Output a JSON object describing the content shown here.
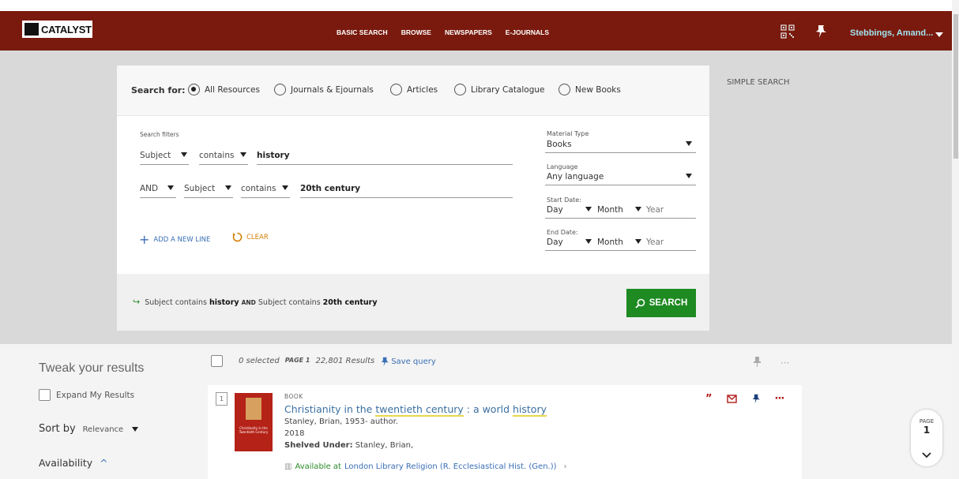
{
  "header": {
    "logo_text": "CATALYST",
    "nav": [
      "BASIC SEARCH",
      "BROWSE",
      "NEWSPAPERS",
      "E-JOURNALS"
    ],
    "user": "Stebbings, Amand...",
    "icons": [
      "qr-code-icon",
      "pin-icon",
      "caret-down-icon"
    ]
  },
  "search": {
    "search_for_label": "Search for:",
    "scopes": [
      {
        "label": "All Resources",
        "selected": true
      },
      {
        "label": "Journals & Ejournals",
        "selected": false
      },
      {
        "label": "Articles",
        "selected": false
      },
      {
        "label": "Library Catalogue",
        "selected": false
      },
      {
        "label": "New Books",
        "selected": false
      }
    ],
    "filters_label": "Search filters",
    "line1": {
      "field": "Subject",
      "op": "contains",
      "value": "history"
    },
    "line2": {
      "bool": "AND",
      "field": "Subject",
      "op": "contains",
      "value": "20th century"
    },
    "add_line": "ADD A NEW LINE",
    "clear": "CLEAR",
    "material_type": {
      "label": "Material Type",
      "value": "Books"
    },
    "language": {
      "label": "Language",
      "value": "Any language"
    },
    "start_date": {
      "label": "Start Date:",
      "day": "Day",
      "month": "Month",
      "year": "Year"
    },
    "end_date": {
      "label": "End Date:",
      "day": "Day",
      "month": "Month",
      "year": "Year"
    },
    "summary": {
      "part1": "Subject contains",
      "term1": "history",
      "and": "AND",
      "part2": "Subject contains",
      "term2": "20th century"
    },
    "search_button": "SEARCH",
    "simple_search": "SIMPLE SEARCH"
  },
  "results": {
    "tweak_title": "Tweak your results",
    "expand": "Expand My Results",
    "sort_label": "Sort by",
    "sort_value": "Relevance",
    "availability": "Availability",
    "selected": "0 selected",
    "page": "PAGE 1",
    "count": "22,801 Results",
    "save_query": "Save query",
    "item": {
      "num": "1",
      "type": "BOOK",
      "title_a": "Christianity in the ",
      "title_hl1": "twentieth century",
      "title_b": " : a world ",
      "title_hl2": "history",
      "author": "Stanley, Brian, 1953- author.",
      "year": "2018",
      "shelved_label": "Shelved Under:",
      "shelved_value": "Stanley, Brian,",
      "available_at": "Available at",
      "location": "London Library  Religion (R. Ecclesiastical Hist. (Gen.))",
      "cover_text": "Christianity in the Twentieth Century"
    },
    "page_indicator": {
      "label": "PAGE",
      "number": "1"
    }
  }
}
